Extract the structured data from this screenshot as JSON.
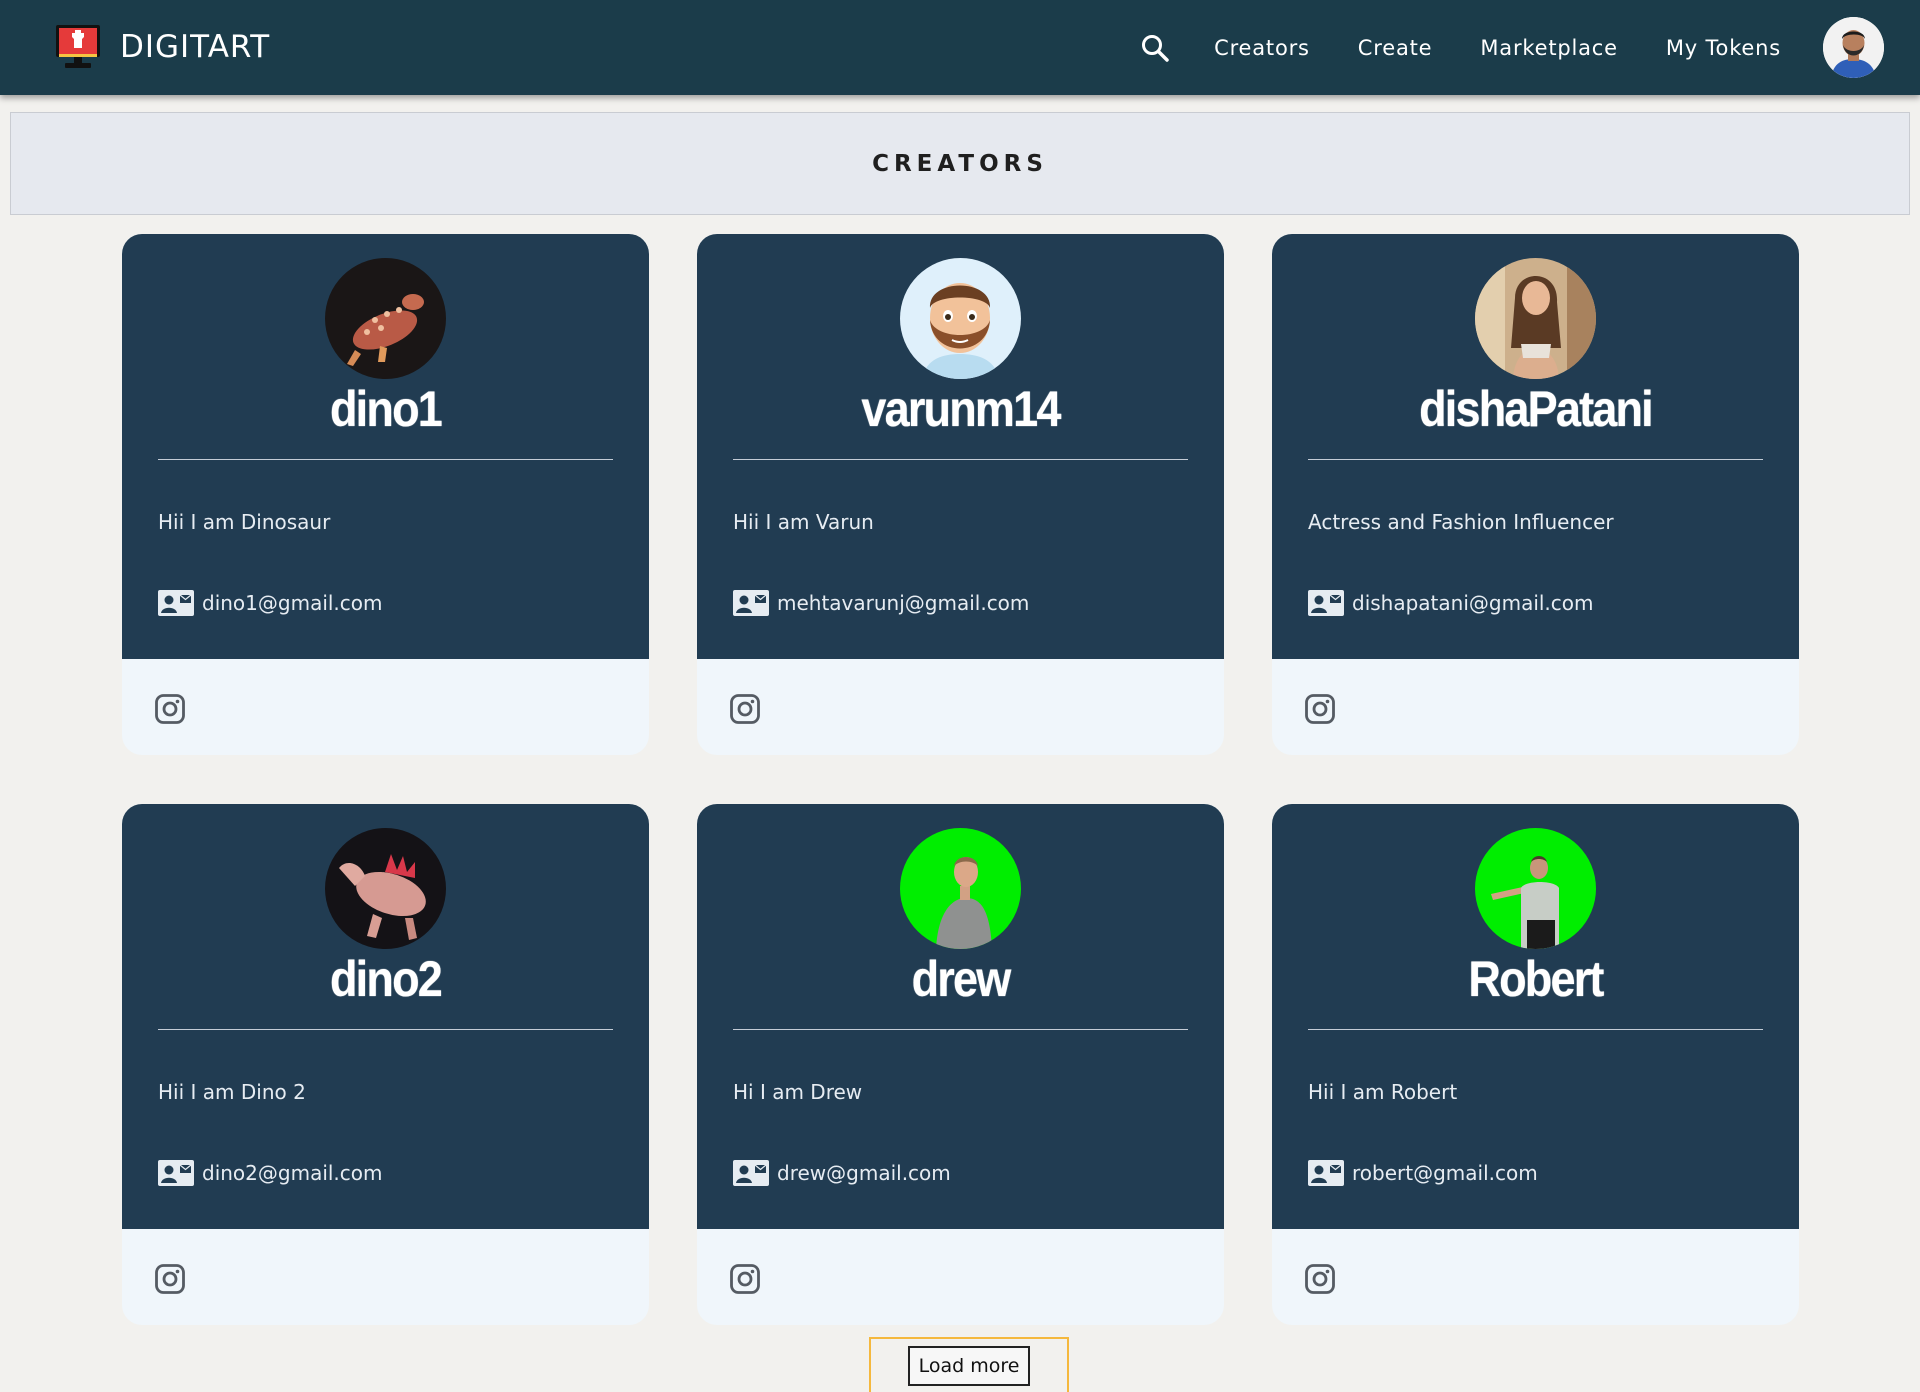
{
  "navbar": {
    "brand": "DIGITART",
    "links": [
      "Creators",
      "Create",
      "Marketplace",
      "My Tokens"
    ]
  },
  "page": {
    "title": "CREATORS"
  },
  "creators": [
    {
      "username": "dino1",
      "bio": "Hii I am Dinosaur",
      "email": "dino1@gmail.com"
    },
    {
      "username": "varunm14",
      "bio": "Hii I am Varun",
      "email": "mehtavarunj@gmail.com"
    },
    {
      "username": "dishaPatani",
      "bio": "Actress and Fashion Influencer",
      "email": "dishapatani@gmail.com"
    },
    {
      "username": "dino2",
      "bio": "Hii I am Dino 2",
      "email": "dino2@gmail.com"
    },
    {
      "username": "drew",
      "bio": "Hi I am Drew",
      "email": "drew@gmail.com"
    },
    {
      "username": "Robert",
      "bio": "Hii I am Robert",
      "email": "robert@gmail.com"
    }
  ],
  "load_more": {
    "label": "Load more"
  },
  "colors": {
    "navbar": "#1b3c4a",
    "card_top": "#213c52",
    "card_bottom": "#f0f6fb",
    "page_background": "#f2f1ee",
    "load_more_focus": "#f5b83d"
  },
  "icons": [
    "monitor-logo-icon",
    "search-icon",
    "profile-avatar",
    "contact-card-icon",
    "instagram-icon"
  ]
}
